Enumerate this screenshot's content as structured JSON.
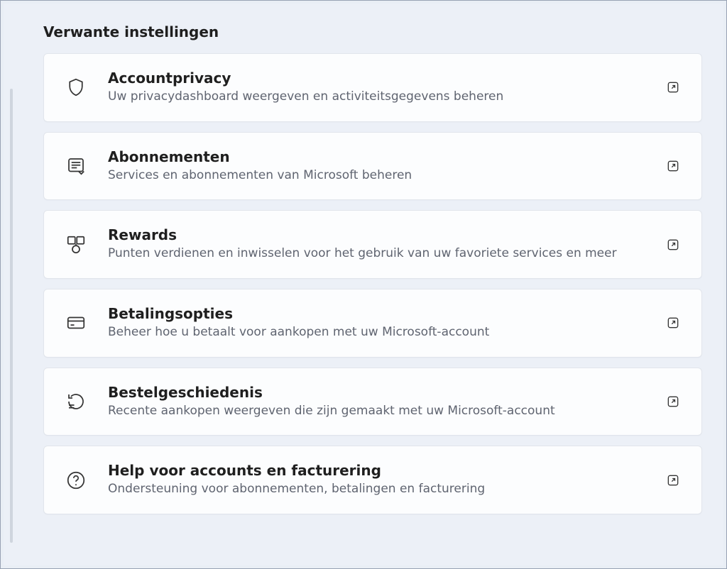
{
  "section_title": "Verwante instellingen",
  "items": [
    {
      "icon": "shield",
      "title": "Accountprivacy",
      "desc": "Uw privacydashboard weergeven en activiteitsgegevens beheren"
    },
    {
      "icon": "subscription",
      "title": "Abonnementen",
      "desc": "Services en abonnementen van Microsoft beheren"
    },
    {
      "icon": "rewards",
      "title": "Rewards",
      "desc": "Punten verdienen en inwisselen voor het gebruik van uw favoriete services en meer"
    },
    {
      "icon": "card",
      "title": "Betalingsopties",
      "desc": "Beheer hoe u betaalt voor aankopen met uw Microsoft-account"
    },
    {
      "icon": "history",
      "title": "Bestelgeschiedenis",
      "desc": "Recente aankopen weergeven die zijn gemaakt met uw Microsoft-account"
    },
    {
      "icon": "help",
      "title": "Help voor accounts en facturering",
      "desc": "Ondersteuning voor abonnementen, betalingen en facturering"
    }
  ]
}
